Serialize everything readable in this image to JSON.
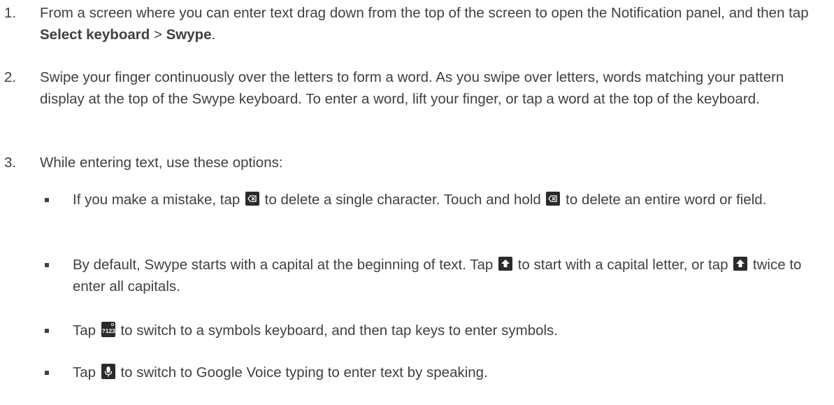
{
  "steps": [
    {
      "number": "1.",
      "text_a": "From a screen where you can enter text drag down from the top of the screen to open the Notification panel, and then tap ",
      "bold_1": "Select keyboard",
      "sep": " > ",
      "bold_2": "Swype",
      "end": "."
    },
    {
      "number": "2.",
      "text": "Swipe your finger continuously over the letters to form a word. As you swipe over letters, words matching your pattern display at the top of the Swype keyboard. To enter a word, lift your finger, or tap a word at the top of the keyboard."
    },
    {
      "number": "3.",
      "text": "While entering text, use these options:"
    }
  ],
  "options": [
    {
      "p1": "If you make a mistake, tap ",
      "icon1": "delete-key-icon",
      "p2": " to delete a single character. Touch and hold ",
      "icon2": "delete-key-icon",
      "p3": " to delete an entire word or field."
    },
    {
      "p1": "By default, Swype starts with a capital at the beginning of text. Tap ",
      "icon1": "shift-key-icon",
      "p2": " to start with a capital letter, or tap ",
      "icon2": "shift-key-icon",
      "p3": " twice to enter all capitals."
    },
    {
      "p1": "Tap ",
      "icon1": "symbols-key-icon",
      "icon1_label": "?123",
      "p2": " to switch to a symbols keyboard, and then tap keys to enter symbols."
    },
    {
      "p1": "Tap ",
      "icon1": "microphone-key-icon",
      "p2": " to switch to Google Voice typing to enter text by speaking."
    }
  ],
  "colors": {
    "text": "#404040",
    "icon_bg": "#2b2b2b",
    "icon_fg": "#ffffff"
  }
}
